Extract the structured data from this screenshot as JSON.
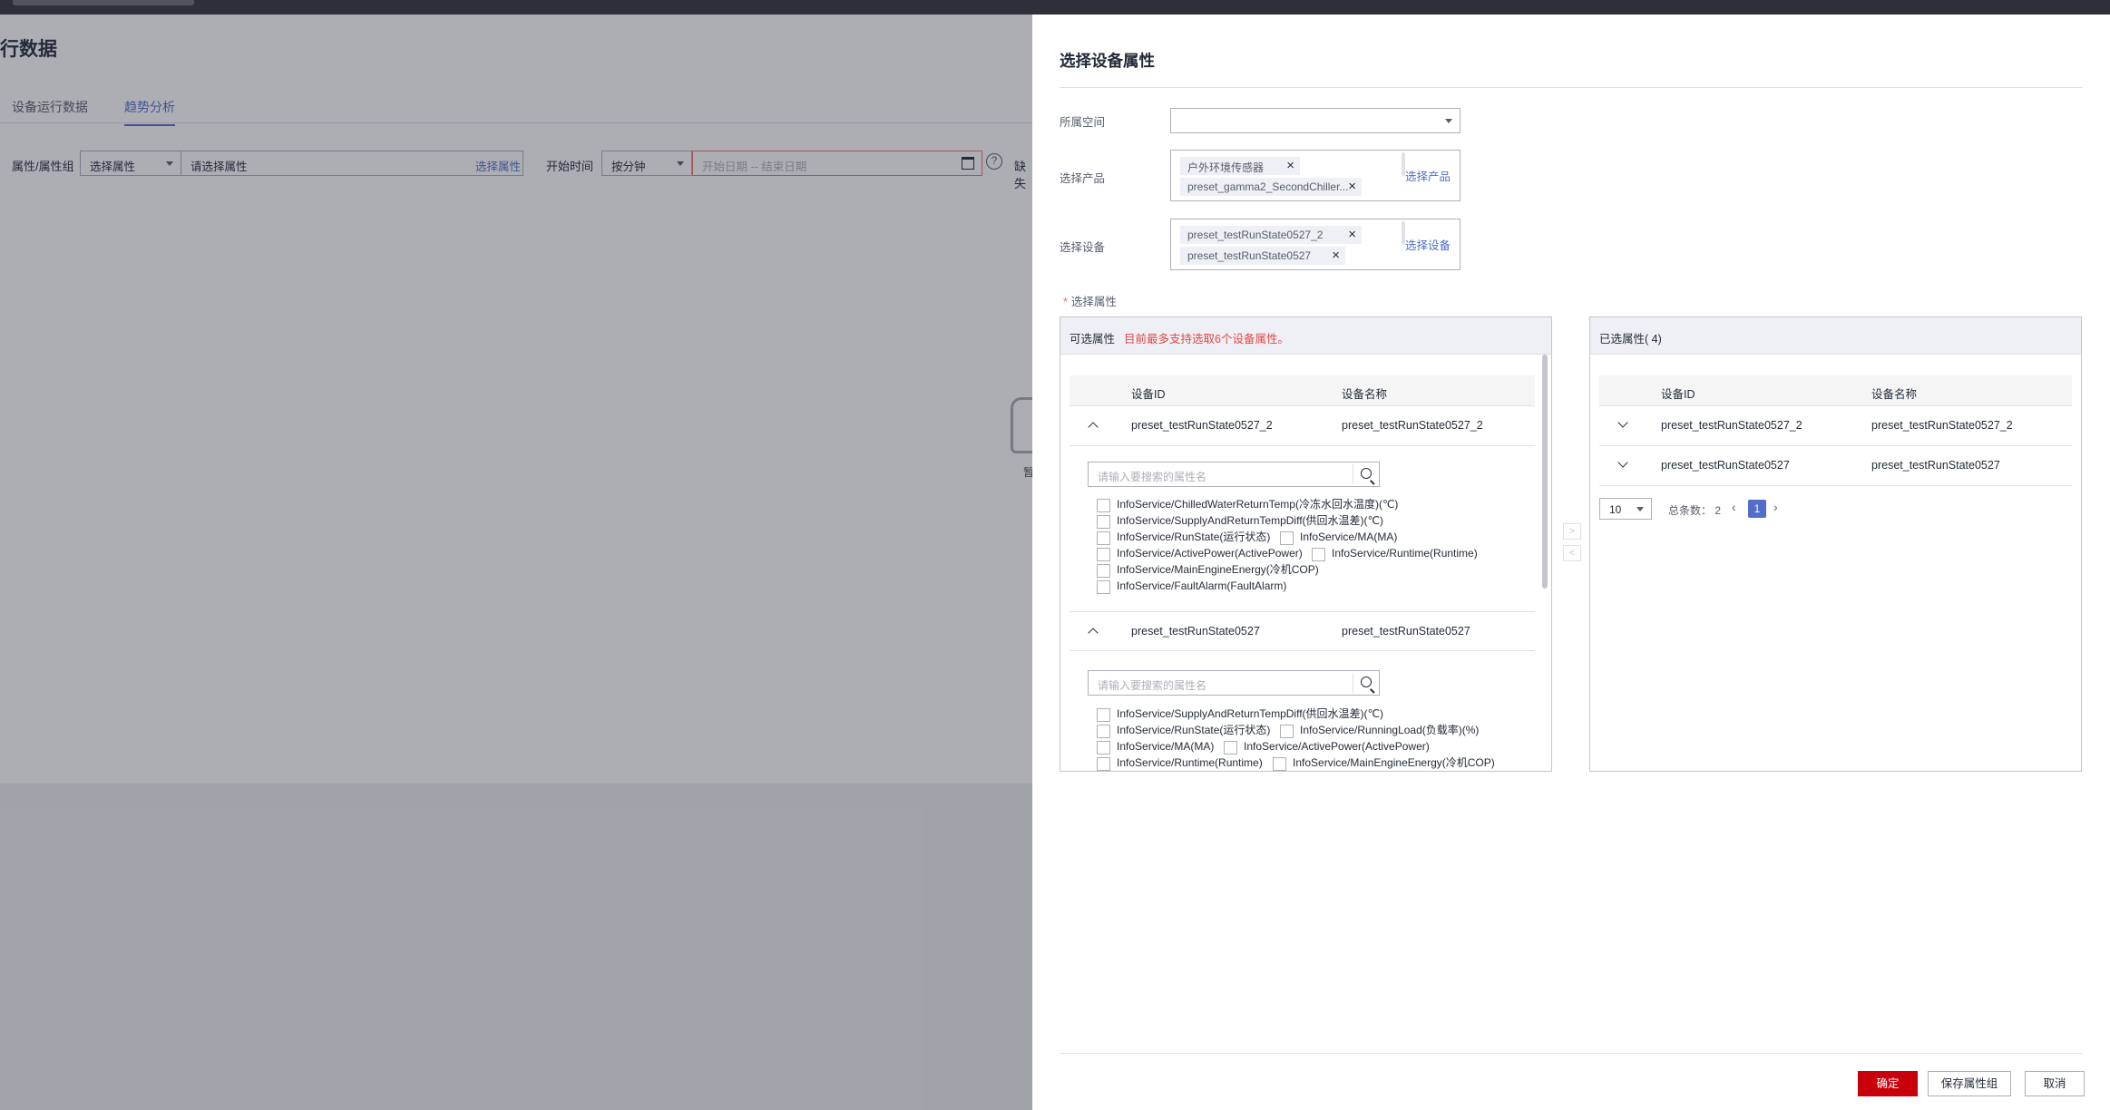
{
  "page": {
    "title": "行数据",
    "tabs": [
      {
        "label": "设备运行数据",
        "active": false
      },
      {
        "label": "趋势分析",
        "active": true
      }
    ],
    "filters": {
      "attr_group_label": "属性/属性组",
      "attr_select": "选择属性",
      "attr_input_placeholder": "请选择属性",
      "attr_link": "选择属性",
      "start_time_label": "开始时间",
      "granularity": "按分钟",
      "date_placeholder": "开始日期 -- 结束日期",
      "trailing_label": "缺失"
    },
    "empty_state_text": "暂"
  },
  "drawer": {
    "title": "选择设备属性",
    "space": {
      "label": "所属空间",
      "value": ""
    },
    "product": {
      "label": "选择产品",
      "tags": [
        "户外环境传感器",
        "preset_gamma2_SecondChiller..."
      ],
      "link": "选择产品"
    },
    "device": {
      "label": "选择设备",
      "tags": [
        "preset_testRunState0527_2",
        "preset_testRunState0527"
      ],
      "link": "选择设备"
    },
    "attr_label": "选择属性",
    "available": {
      "title": "可选属性",
      "warning": "目前最多支持选取6个设备属性。",
      "columns": [
        "设备ID",
        "设备名称"
      ],
      "groups": [
        {
          "id": "preset_testRunState0527_2",
          "name": "preset_testRunState0527_2",
          "search_placeholder": "请输入要搜索的属性名",
          "attrs": [
            [
              "InfoService/ChilledWaterReturnTemp(冷冻水回水温度)(℃)"
            ],
            [
              "InfoService/SupplyAndReturnTempDiff(供回水温差)(℃)"
            ],
            [
              "InfoService/RunState(运行状态)",
              "InfoService/MA(MA)"
            ],
            [
              "InfoService/ActivePower(ActivePower)",
              "InfoService/Runtime(Runtime)"
            ],
            [
              "InfoService/MainEngineEnergy(冷机COP)"
            ],
            [
              "InfoService/FaultAlarm(FaultAlarm)"
            ]
          ]
        },
        {
          "id": "preset_testRunState0527",
          "name": "preset_testRunState0527",
          "search_placeholder": "请输入要搜索的属性名",
          "attrs": [
            [
              "InfoService/SupplyAndReturnTempDiff(供回水温差)(℃)"
            ],
            [
              "InfoService/RunState(运行状态)",
              "InfoService/RunningLoad(负载率)(%)"
            ],
            [
              "InfoService/MA(MA)",
              "InfoService/ActivePower(ActivePower)"
            ],
            [
              "InfoService/Runtime(Runtime)",
              "InfoService/MainEngineEnergy(冷机COP)"
            ]
          ]
        }
      ]
    },
    "selected": {
      "title": "已选属性( 4)",
      "columns": [
        "设备ID",
        "设备名称"
      ],
      "rows": [
        {
          "id": "preset_testRunState0527_2",
          "name": "preset_testRunState0527_2"
        },
        {
          "id": "preset_testRunState0527",
          "name": "preset_testRunState0527"
        }
      ],
      "pager": {
        "page_size": "10",
        "total": "总条数： 2",
        "current": "1"
      }
    },
    "buttons": {
      "confirm": "确定",
      "save_group": "保存属性组",
      "cancel": "取消"
    }
  },
  "colors": {
    "accent": "#526ecc",
    "primary_button": "#c7000b",
    "warning": "#e54545"
  }
}
